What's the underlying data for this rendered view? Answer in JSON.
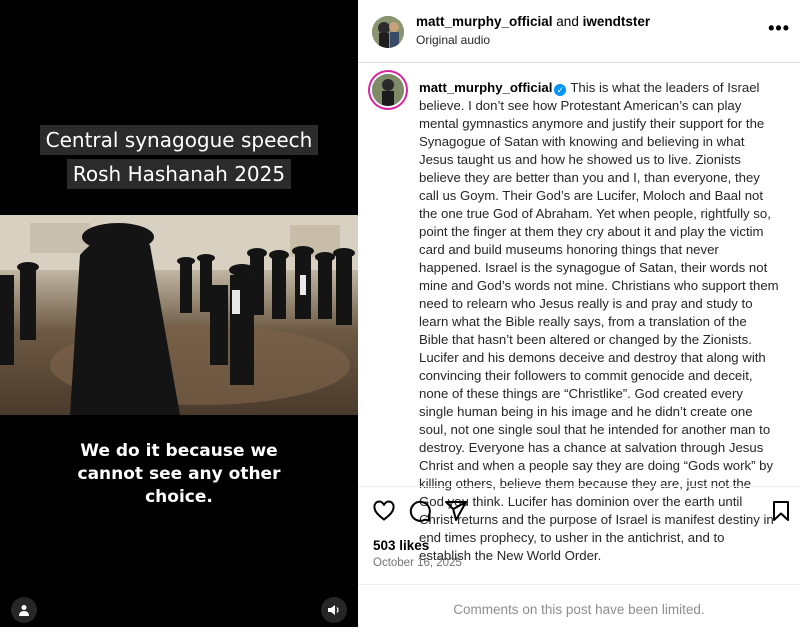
{
  "video": {
    "caption_top_line1": "Central synagogue speech",
    "caption_top_line2": "Rosh Hashanah 2025",
    "caption_bottom_line1": "We do it because we",
    "caption_bottom_line2": "cannot see any other",
    "caption_bottom_line3": "choice.",
    "profile_button_icon": "person-icon",
    "audio_button_icon": "speaker-icon"
  },
  "header": {
    "user1": "matt_murphy_official",
    "connector": "and",
    "user2": "iwendtster",
    "audio": "Original audio",
    "more_icon": "more-horizontal-icon"
  },
  "post": {
    "username": "matt_murphy_official",
    "verified": true,
    "text": "This is what the leaders of Israel believe. I don’t see how Protestant American’s can play mental gymnastics anymore and justify their support for the Synagogue of Satan with knowing and believing in what Jesus taught us and how he showed us to live. Zionists believe they are better than you and I, than everyone, they call us Goym. Their God’s are Lucifer, Moloch and Baal not the one true God of Abraham. Yet when people, rightfully so, point the finger at them they cry about it and play the victim card and build museums honoring things that never happened. Israel is the synagogue of Satan, their words not mine and God’s words not mine. Christians who support them need to relearn who Jesus really is and pray and study to learn what the Bible really says, from a translation of the Bible that hasn’t been altered or changed by the Zionists. Lucifer and his demons deceive and destroy that along with convincing their followers to commit genocide and deceit, none of these things are “Christlike”. God created every single human being in his image and he didn’t create one soul, not one single soul that he intended for another man to destroy. Everyone has a chance at salvation through Jesus Christ and when a people say they are doing “Gods work” by killing others, believe them because they are, just not the God you think. Lucifer has dominion over the earth until Christ returns and the purpose of Israel is manifest destiny in end times prophecy, to usher in the antichrist, and to establish the New World Order."
  },
  "actions": {
    "like_icon": "heart-icon",
    "comment_icon": "comment-icon",
    "share_icon": "send-icon",
    "save_icon": "bookmark-icon"
  },
  "likes": "503 likes",
  "date": "October 16, 2025",
  "comments_limited": "Comments on this post have been limited.",
  "colors": {
    "verified": "#0095f6",
    "video_bg": "#000000",
    "muted_text": "#8e8e8e"
  }
}
